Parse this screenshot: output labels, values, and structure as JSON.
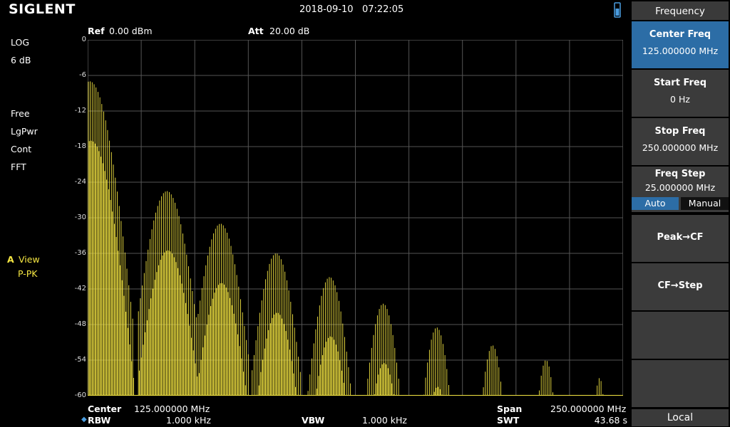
{
  "header": {
    "brand": "SIGLENT",
    "datetime": "2018-09-10   07:22:05"
  },
  "left_panel": {
    "scale_type": "LOG",
    "scale_div": "6 dB",
    "trig": "Free",
    "det_type": "LgPwr",
    "sweep": "Cont",
    "mode": "FFT",
    "trace_id": "A",
    "trace_mode": "View",
    "detector": "P-PK"
  },
  "top_info": {
    "ref_label": "Ref",
    "ref_value": "0.00 dBm",
    "att_label": "Att",
    "att_value": "20.00 dB"
  },
  "bottom_info": {
    "center_label": "Center",
    "center_value": "125.000000 MHz",
    "rbw_label": "RBW",
    "rbw_value": "1.000 kHz",
    "vbw_label": "VBW",
    "vbw_value": "1.000 kHz",
    "span_label": "Span",
    "span_value": "250.000000 MHz",
    "swt_label": "SWT",
    "swt_value": "43.68 s"
  },
  "menu": {
    "title": "Frequency",
    "center_freq": {
      "label": "Center Freq",
      "value": "125.000000 MHz"
    },
    "start_freq": {
      "label": "Start Freq",
      "value": "0 Hz"
    },
    "stop_freq": {
      "label": "Stop Freq",
      "value": "250.000000 MHz"
    },
    "freq_step": {
      "label": "Freq Step",
      "value": "25.000000 MHz",
      "auto": "Auto",
      "manual": "Manual"
    },
    "peak_cf": "Peak→CF",
    "cf_step": "CF→Step",
    "local": "Local"
  },
  "chart_data": {
    "type": "line",
    "yaxis_ticks": [
      "0",
      "-6",
      "-12",
      "-18",
      "-24",
      "-30",
      "-36",
      "-42",
      "-48",
      "-54",
      "-60"
    ],
    "ylim": [
      -60,
      0
    ],
    "xlim_mhz": [
      0,
      250
    ],
    "grid": true,
    "trace_color": "#f5e642",
    "lobes": [
      {
        "center_mhz": 1,
        "peak_dbm": -7,
        "width_mhz": 40
      },
      {
        "center_mhz": 37,
        "peak_dbm": -25.5,
        "width_mhz": 28
      },
      {
        "center_mhz": 62,
        "peak_dbm": -31,
        "width_mhz": 26
      },
      {
        "center_mhz": 88,
        "peak_dbm": -36,
        "width_mhz": 24
      },
      {
        "center_mhz": 113,
        "peak_dbm": -40,
        "width_mhz": 22
      },
      {
        "center_mhz": 138,
        "peak_dbm": -44.5,
        "width_mhz": 20
      },
      {
        "center_mhz": 163,
        "peak_dbm": -48.5,
        "width_mhz": 18
      },
      {
        "center_mhz": 189,
        "peak_dbm": -51.5,
        "width_mhz": 16
      },
      {
        "center_mhz": 214,
        "peak_dbm": -54,
        "width_mhz": 14
      },
      {
        "center_mhz": 239,
        "peak_dbm": -57,
        "width_mhz": 10
      }
    ]
  }
}
